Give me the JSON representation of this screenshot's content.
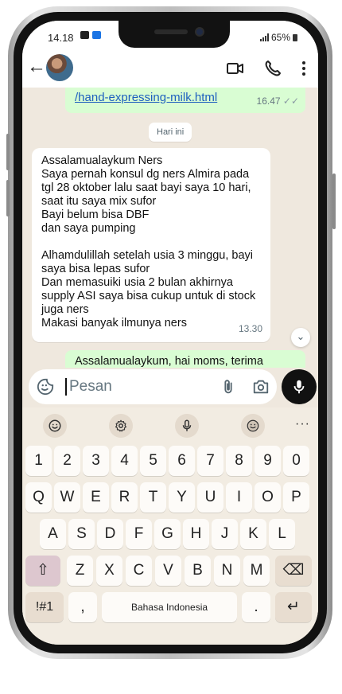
{
  "status_bar": {
    "time": "14.18",
    "battery": "65%"
  },
  "chat": {
    "top_message": {
      "link": "/hand-expressing-milk.html",
      "time": "16.47",
      "ticks": "✓✓"
    },
    "date_chip": "Hari ini",
    "incoming_message": {
      "lines": [
        "Assalamualaykum Ners",
        "Saya pernah konsul dg ners Almira pada",
        "tgl 28 oktober lalu saat bayi saya 10 hari,",
        "saat itu saya mix sufor",
        "Bayi belum bisa DBF",
        "dan saya pumping",
        "",
        "Alhamdulillah setelah usia 3 minggu, bayi",
        "saya bisa lepas sufor",
        "Dan memasuiki usia 2 bulan akhirnya",
        "supply ASI saya bisa cukup untuk di stock",
        "juga ners",
        "Makasi banyak ilmunya ners"
      ],
      "time": "13.30"
    },
    "bottom_message_preview": "Assalamualaykum, hai moms, terima"
  },
  "input": {
    "placeholder": "Pesan"
  },
  "keyboard": {
    "toolbar_icons": [
      "emoji-icon",
      "settings-icon",
      "mic-icon",
      "sticker-icon"
    ],
    "more": "···",
    "row_numbers": [
      "1",
      "2",
      "3",
      "4",
      "5",
      "6",
      "7",
      "8",
      "9",
      "0"
    ],
    "row_q": [
      "Q",
      "W",
      "E",
      "R",
      "T",
      "Y",
      "U",
      "I",
      "O",
      "P"
    ],
    "row_a": [
      "A",
      "S",
      "D",
      "F",
      "G",
      "H",
      "J",
      "K",
      "L"
    ],
    "row_z": [
      "Z",
      "X",
      "C",
      "V",
      "B",
      "N",
      "M"
    ],
    "symbols_key": "!#1",
    "comma_key": ",",
    "space_label": "Bahasa Indonesia",
    "period_key": ".",
    "shift_glyph": "⇧",
    "backspace_glyph": "⌫",
    "enter_glyph": "↵"
  },
  "colors": {
    "outgoing_bubble": "#d9fdd3",
    "incoming_bubble": "#ffffff",
    "chat_background": "#efe8de",
    "link": "#1d5fbf",
    "mic_button": "#111111"
  }
}
